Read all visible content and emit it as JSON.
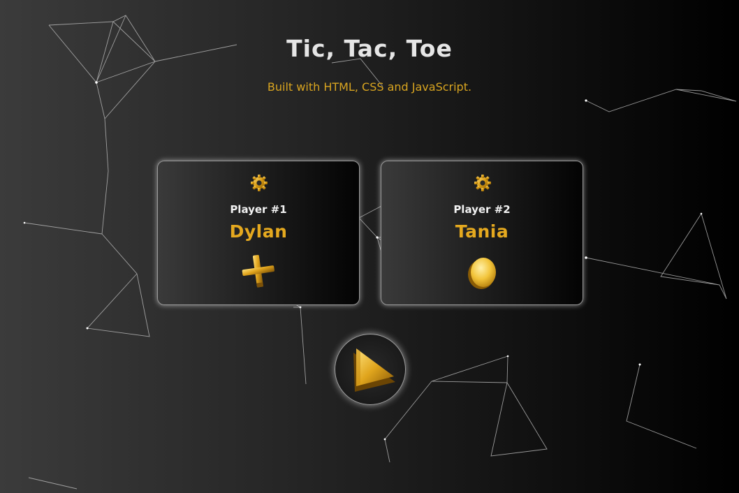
{
  "header": {
    "title": "Tic, Tac, Toe",
    "subtitle": "Built with HTML, CSS and JavaScript."
  },
  "players": [
    {
      "label": "Player #1",
      "name": "Dylan",
      "mark": "cross-icon",
      "settings_icon": "gear-icon"
    },
    {
      "label": "Player #2",
      "name": "Tania",
      "mark": "circle-icon",
      "settings_icon": "gear-icon"
    }
  ],
  "controls": {
    "play_icon": "play-icon"
  },
  "colors": {
    "accent": "#e5a91f",
    "title": "#e6e6e6",
    "network_lines": "#bdbdbd"
  }
}
